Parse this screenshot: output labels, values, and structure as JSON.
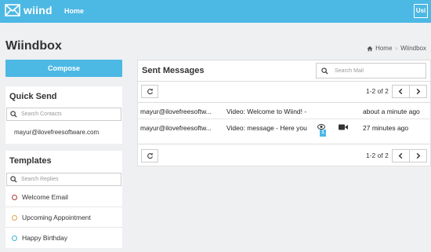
{
  "app": {
    "logo_text": "wiind",
    "nav_home": "Home",
    "user_initials": "Usi"
  },
  "page": {
    "title": "Wiindbox",
    "breadcrumb": [
      "Home",
      "Wiindbox"
    ]
  },
  "sidebar": {
    "compose_label": "Compose",
    "quick_send": {
      "title": "Quick Send",
      "search_placeholder": "Search Contacts",
      "contacts": [
        "mayur@ilovefreesoftware.com"
      ]
    },
    "templates": {
      "title": "Templates",
      "search_placeholder": "Search Replies",
      "items": [
        {
          "label": "Welcome Email",
          "color": "#b03a3a"
        },
        {
          "label": "Upcoming Appointment",
          "color": "#e0a050"
        },
        {
          "label": "Happy Birthday",
          "color": "#3fb0d8"
        }
      ]
    }
  },
  "sent": {
    "title": "Sent Messages",
    "search_placeholder": "Search Mail",
    "pager_top": "1-2 of 2",
    "pager_bottom": "1-2 of 2",
    "rows": [
      {
        "to": "mayur@ilovefreesoftw...",
        "subject": "Video: Welcome to Wiind! -",
        "time": "about a minute ago",
        "views": "",
        "has_video": false
      },
      {
        "to": "mayur@ilovefreesoftw...",
        "subject": "Video: message - Here you",
        "time": "27 minutes ago",
        "views": "1",
        "has_video": true
      }
    ]
  },
  "colors": {
    "accent": "#4cb8e4",
    "background": "#eef0f2"
  }
}
